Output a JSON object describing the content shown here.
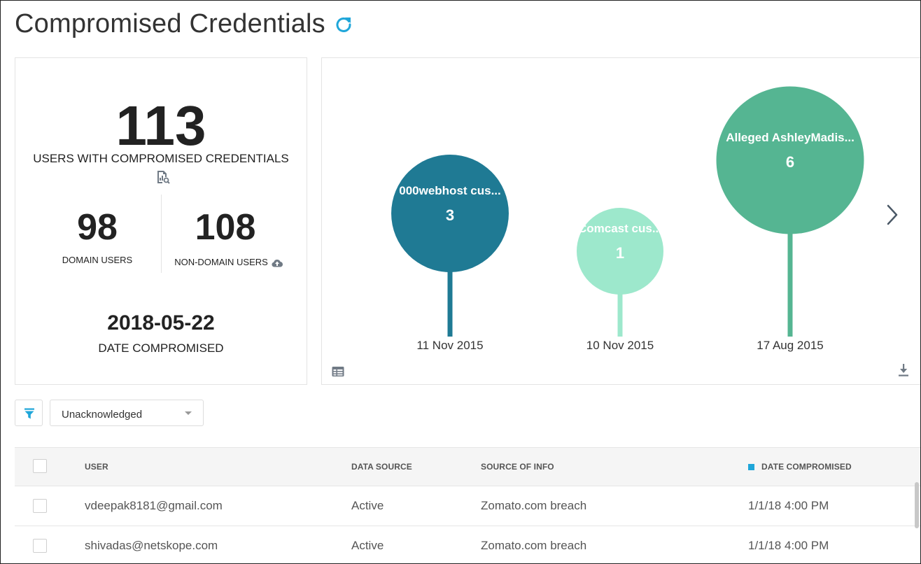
{
  "header": {
    "title": "Compromised Credentials"
  },
  "summary": {
    "total_users": "113",
    "total_label": "USERS WITH COMPROMISED CREDENTIALS",
    "domain_users": "98",
    "domain_label": "DOMAIN USERS",
    "non_domain_users": "108",
    "non_domain_label": "NON-DOMAIN USERS",
    "date_compromised": "2018-05-22",
    "date_label": "DATE COMPROMISED"
  },
  "chart_data": {
    "type": "bubble-timeline",
    "title": "",
    "xlabel": "",
    "ylabel": "",
    "points": [
      {
        "label": "000webhost cus...",
        "value": 3,
        "date": "11 Nov 2015",
        "color": "#1f7a94"
      },
      {
        "label": "Comcast cus...",
        "value": 1,
        "date": "10 Nov 2015",
        "color": "#9de8cc"
      },
      {
        "label": "Alleged AshleyMadis...",
        "value": 6,
        "date": "17 Aug 2015",
        "color": "#55b592"
      }
    ]
  },
  "filters": {
    "status_value": "Unacknowledged"
  },
  "table": {
    "columns": [
      "USER",
      "DATA SOURCE",
      "SOURCE OF INFO",
      "DATE COMPROMISED"
    ],
    "rows": [
      {
        "user": "vdeepak8181@gmail.com",
        "data_source": "Active",
        "source_of_info": "Zomato.com breach",
        "date": "1/1/18 4:00 PM"
      },
      {
        "user": "shivadas@netskope.com",
        "data_source": "Active",
        "source_of_info": "Zomato.com breach",
        "date": "1/1/18 4:00 PM"
      }
    ]
  },
  "colors": {
    "accent": "#1fa6d9",
    "text": "#333333",
    "border": "#e3e3e3"
  }
}
